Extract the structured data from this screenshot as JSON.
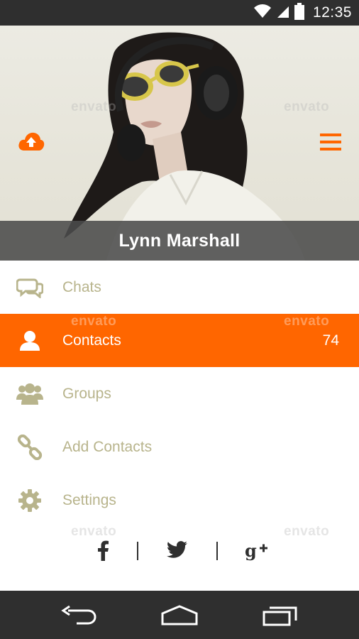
{
  "status_bar": {
    "time": "12:35"
  },
  "profile": {
    "name": "Lynn Marshall"
  },
  "menu": {
    "items": [
      {
        "label": "Chats",
        "icon": "chat-icon"
      },
      {
        "label": "Contacts",
        "icon": "user-icon",
        "count": "74",
        "active": true
      },
      {
        "label": "Groups",
        "icon": "group-icon"
      },
      {
        "label": "Add Contacts",
        "icon": "link-icon"
      },
      {
        "label": "Settings",
        "icon": "gear-icon"
      }
    ]
  },
  "social": {
    "facebook": "f",
    "twitter": "twitter-icon",
    "google": "g+"
  },
  "watermark": "envato",
  "colors": {
    "accent": "#ff6600",
    "muted": "#b8b48c",
    "dark": "#2f2f2f"
  }
}
